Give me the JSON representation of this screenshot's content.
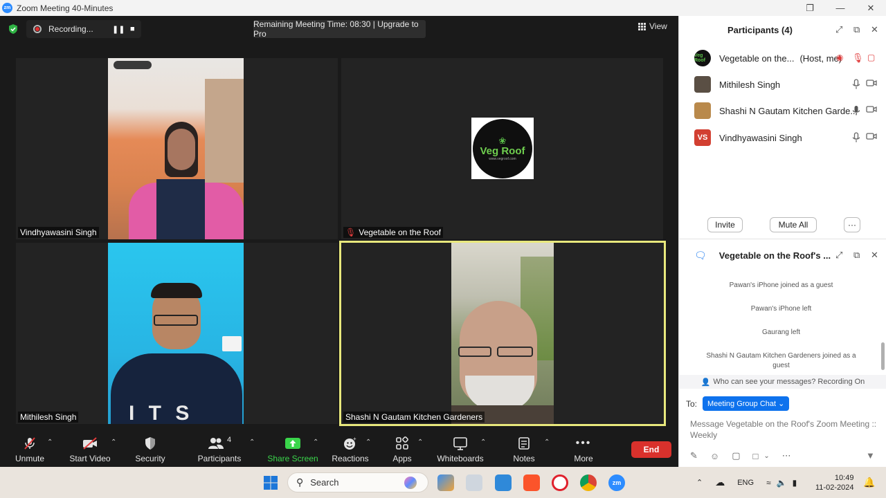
{
  "window": {
    "title": "Zoom Meeting 40-Minutes",
    "app_logo": "zm"
  },
  "meeting_bar": {
    "recording_label": "Recording...",
    "remaining_text": "Remaining Meeting Time: 08:30 | Upgrade to Pro",
    "view_label": "View"
  },
  "tiles": [
    {
      "name": "Vindhyawasini Singh",
      "muted": false
    },
    {
      "name": "Vegetable on the Roof",
      "muted": true,
      "logo_text": "Veg Roof",
      "logo_url": "www.vegroof.com"
    },
    {
      "name": "Mithilesh Singh",
      "muted": false
    },
    {
      "name": "Shashi N Gautam Kitchen Gardeners",
      "muted": false,
      "active_speaker": true
    }
  ],
  "toolbar": {
    "unmute": "Unmute",
    "start_video": "Start Video",
    "security": "Security",
    "participants": "Participants",
    "participants_count": "4",
    "share_screen": "Share Screen",
    "reactions": "Reactions",
    "apps": "Apps",
    "whiteboards": "Whiteboards",
    "notes": "Notes",
    "more": "More",
    "end": "End"
  },
  "participants_panel": {
    "title": "Participants (4)",
    "items": [
      {
        "name": "Vegetable on the...",
        "tag": "(Host, me)"
      },
      {
        "name": "Mithilesh Singh",
        "tag": ""
      },
      {
        "name": "Shashi N Gautam Kitchen Garde...",
        "tag": ""
      },
      {
        "name": "Vindhyawasini Singh",
        "tag": "",
        "initials": "VS"
      }
    ],
    "invite": "Invite",
    "mute_all": "Mute All",
    "more": "···"
  },
  "chat_panel": {
    "title": "Vegetable on the Roof's ...",
    "messages": [
      "Pawan's iPhone joined as a guest",
      "Pawan's iPhone left",
      "Gaurang left",
      "Shashi N Gautam Kitchen Gardeners joined as a guest"
    ],
    "who_can_see": "Who can see your messages? Recording On",
    "to_label": "To:",
    "recipient": "Meeting Group Chat",
    "placeholder": "Message Vegetable on the Roof's Zoom Meeting :: Weekly"
  },
  "taskbar": {
    "search": "Search",
    "lang": "ENG",
    "time": "10:49",
    "date": "11-02-2024"
  },
  "colors": {
    "accent_blue": "#0e72ed",
    "zoom_blue": "#2d8cff",
    "end_red": "#d9312c",
    "share_green": "#3ad54b",
    "speaker_border": "#e8e87c"
  }
}
